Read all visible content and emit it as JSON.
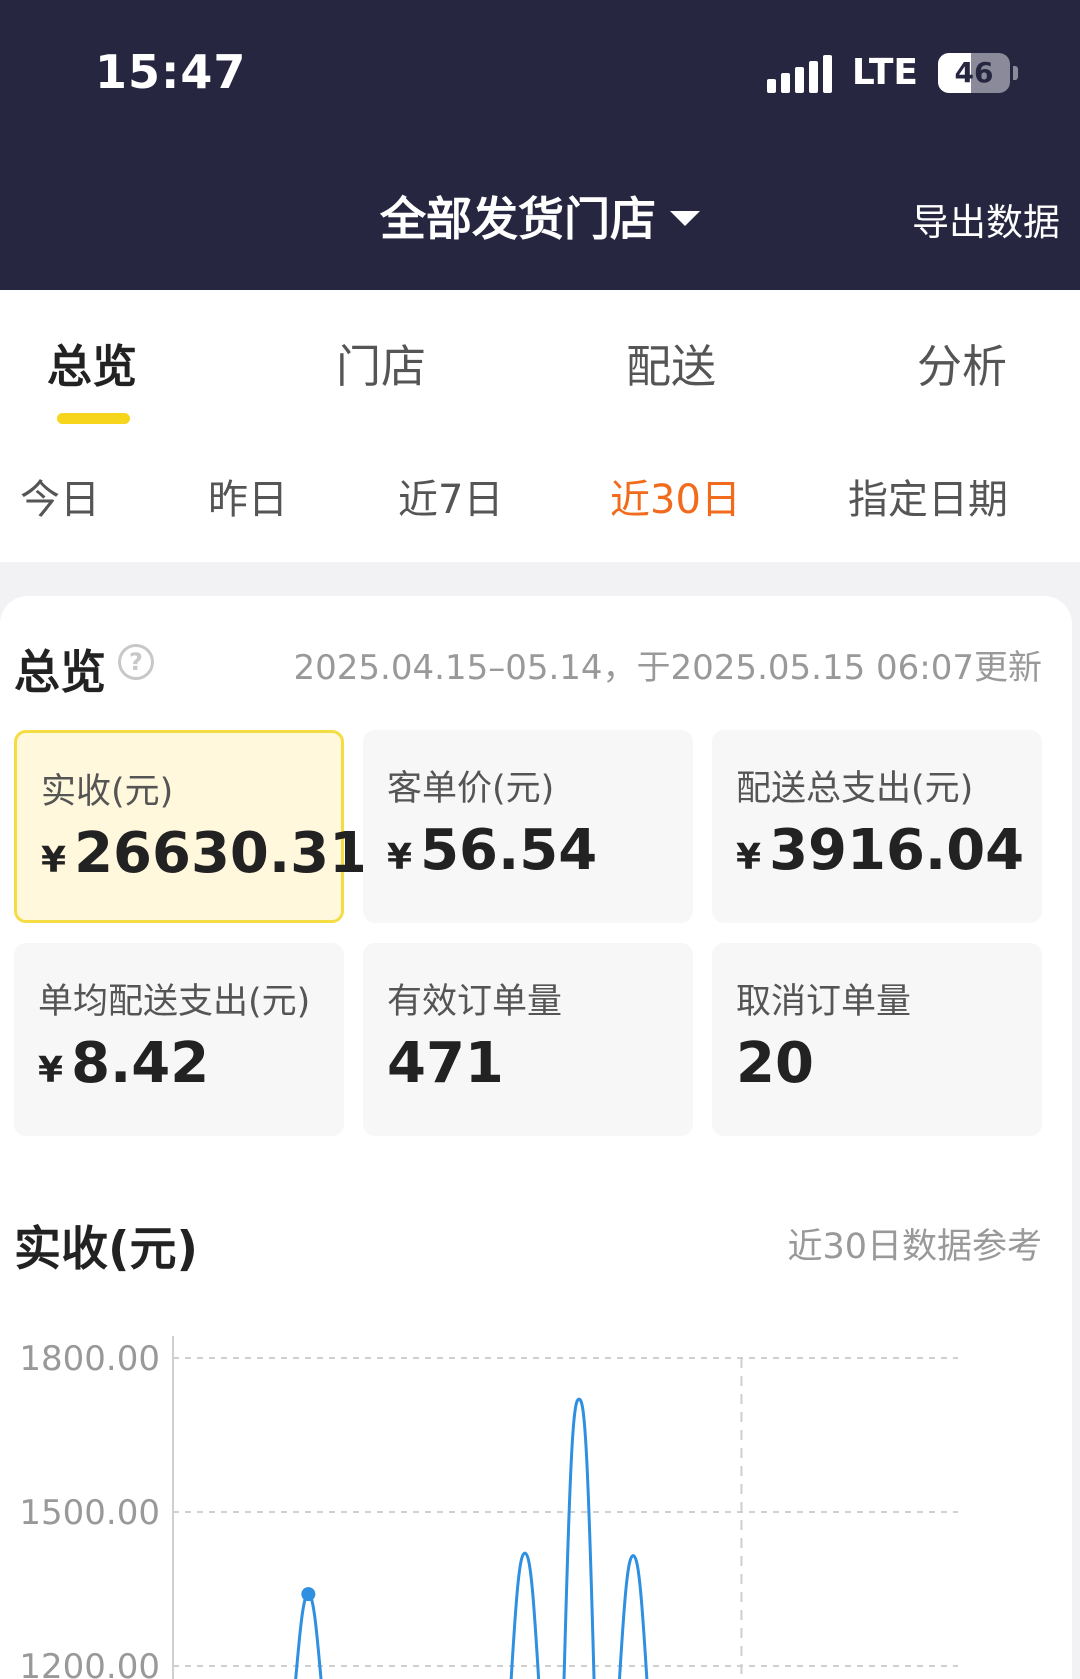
{
  "status_bar": {
    "time": "15:47",
    "network": "LTE",
    "battery": "46",
    "battery_level": 0.46
  },
  "header": {
    "store_selector": "全部发货门店",
    "export_label": "导出数据"
  },
  "tabs": [
    {
      "label": "总览",
      "active": true
    },
    {
      "label": "门店",
      "active": false
    },
    {
      "label": "配送",
      "active": false
    },
    {
      "label": "分析",
      "active": false
    }
  ],
  "date_ranges": [
    {
      "label": "今日",
      "active": false
    },
    {
      "label": "昨日",
      "active": false
    },
    {
      "label": "近7日",
      "active": false
    },
    {
      "label": "近30日",
      "active": true
    },
    {
      "label": "指定日期",
      "active": false
    }
  ],
  "overview": {
    "title": "总览",
    "help_icon": "question-circle-icon",
    "update_text": "2025.04.15–05.14，于2025.05.15 06:07更新",
    "currency_symbol": "¥",
    "metrics": [
      {
        "label": "实收(元)",
        "value": "26630.31",
        "currency": true,
        "highlight": true
      },
      {
        "label": "客单价(元)",
        "value": "56.54",
        "currency": true,
        "highlight": false
      },
      {
        "label": "配送总支出(元)",
        "value": "3916.04",
        "currency": true,
        "highlight": false
      },
      {
        "label": "单均配送支出(元)",
        "value": "8.42",
        "currency": true,
        "highlight": false
      },
      {
        "label": "有效订单量",
        "value": "471",
        "currency": false,
        "highlight": false
      },
      {
        "label": "取消订单量",
        "value": "20",
        "currency": false,
        "highlight": false
      }
    ]
  },
  "revenue_section": {
    "title": "实收(元)",
    "hint": "近30日数据参考"
  },
  "colors": {
    "header_bg": "#262640",
    "accent_yellow": "#f7d51d",
    "active_orange": "#f26b1d",
    "line_blue": "#2f8fe0"
  },
  "chart_data": {
    "type": "line",
    "title": "",
    "xlabel": "",
    "ylabel": "",
    "y_tick_labels": [
      "1800.00",
      "1500.00",
      "1200.00"
    ],
    "ylim_visible": [
      1200,
      1800
    ],
    "grid": true,
    "highlighted_point": {
      "index": 5,
      "value": 1340
    },
    "peaks": [
      {
        "index": 5,
        "value": 1340
      },
      {
        "index": 13,
        "value": 1420
      },
      {
        "index": 15,
        "value": 1720
      },
      {
        "index": 17,
        "value": 1415
      }
    ]
  }
}
